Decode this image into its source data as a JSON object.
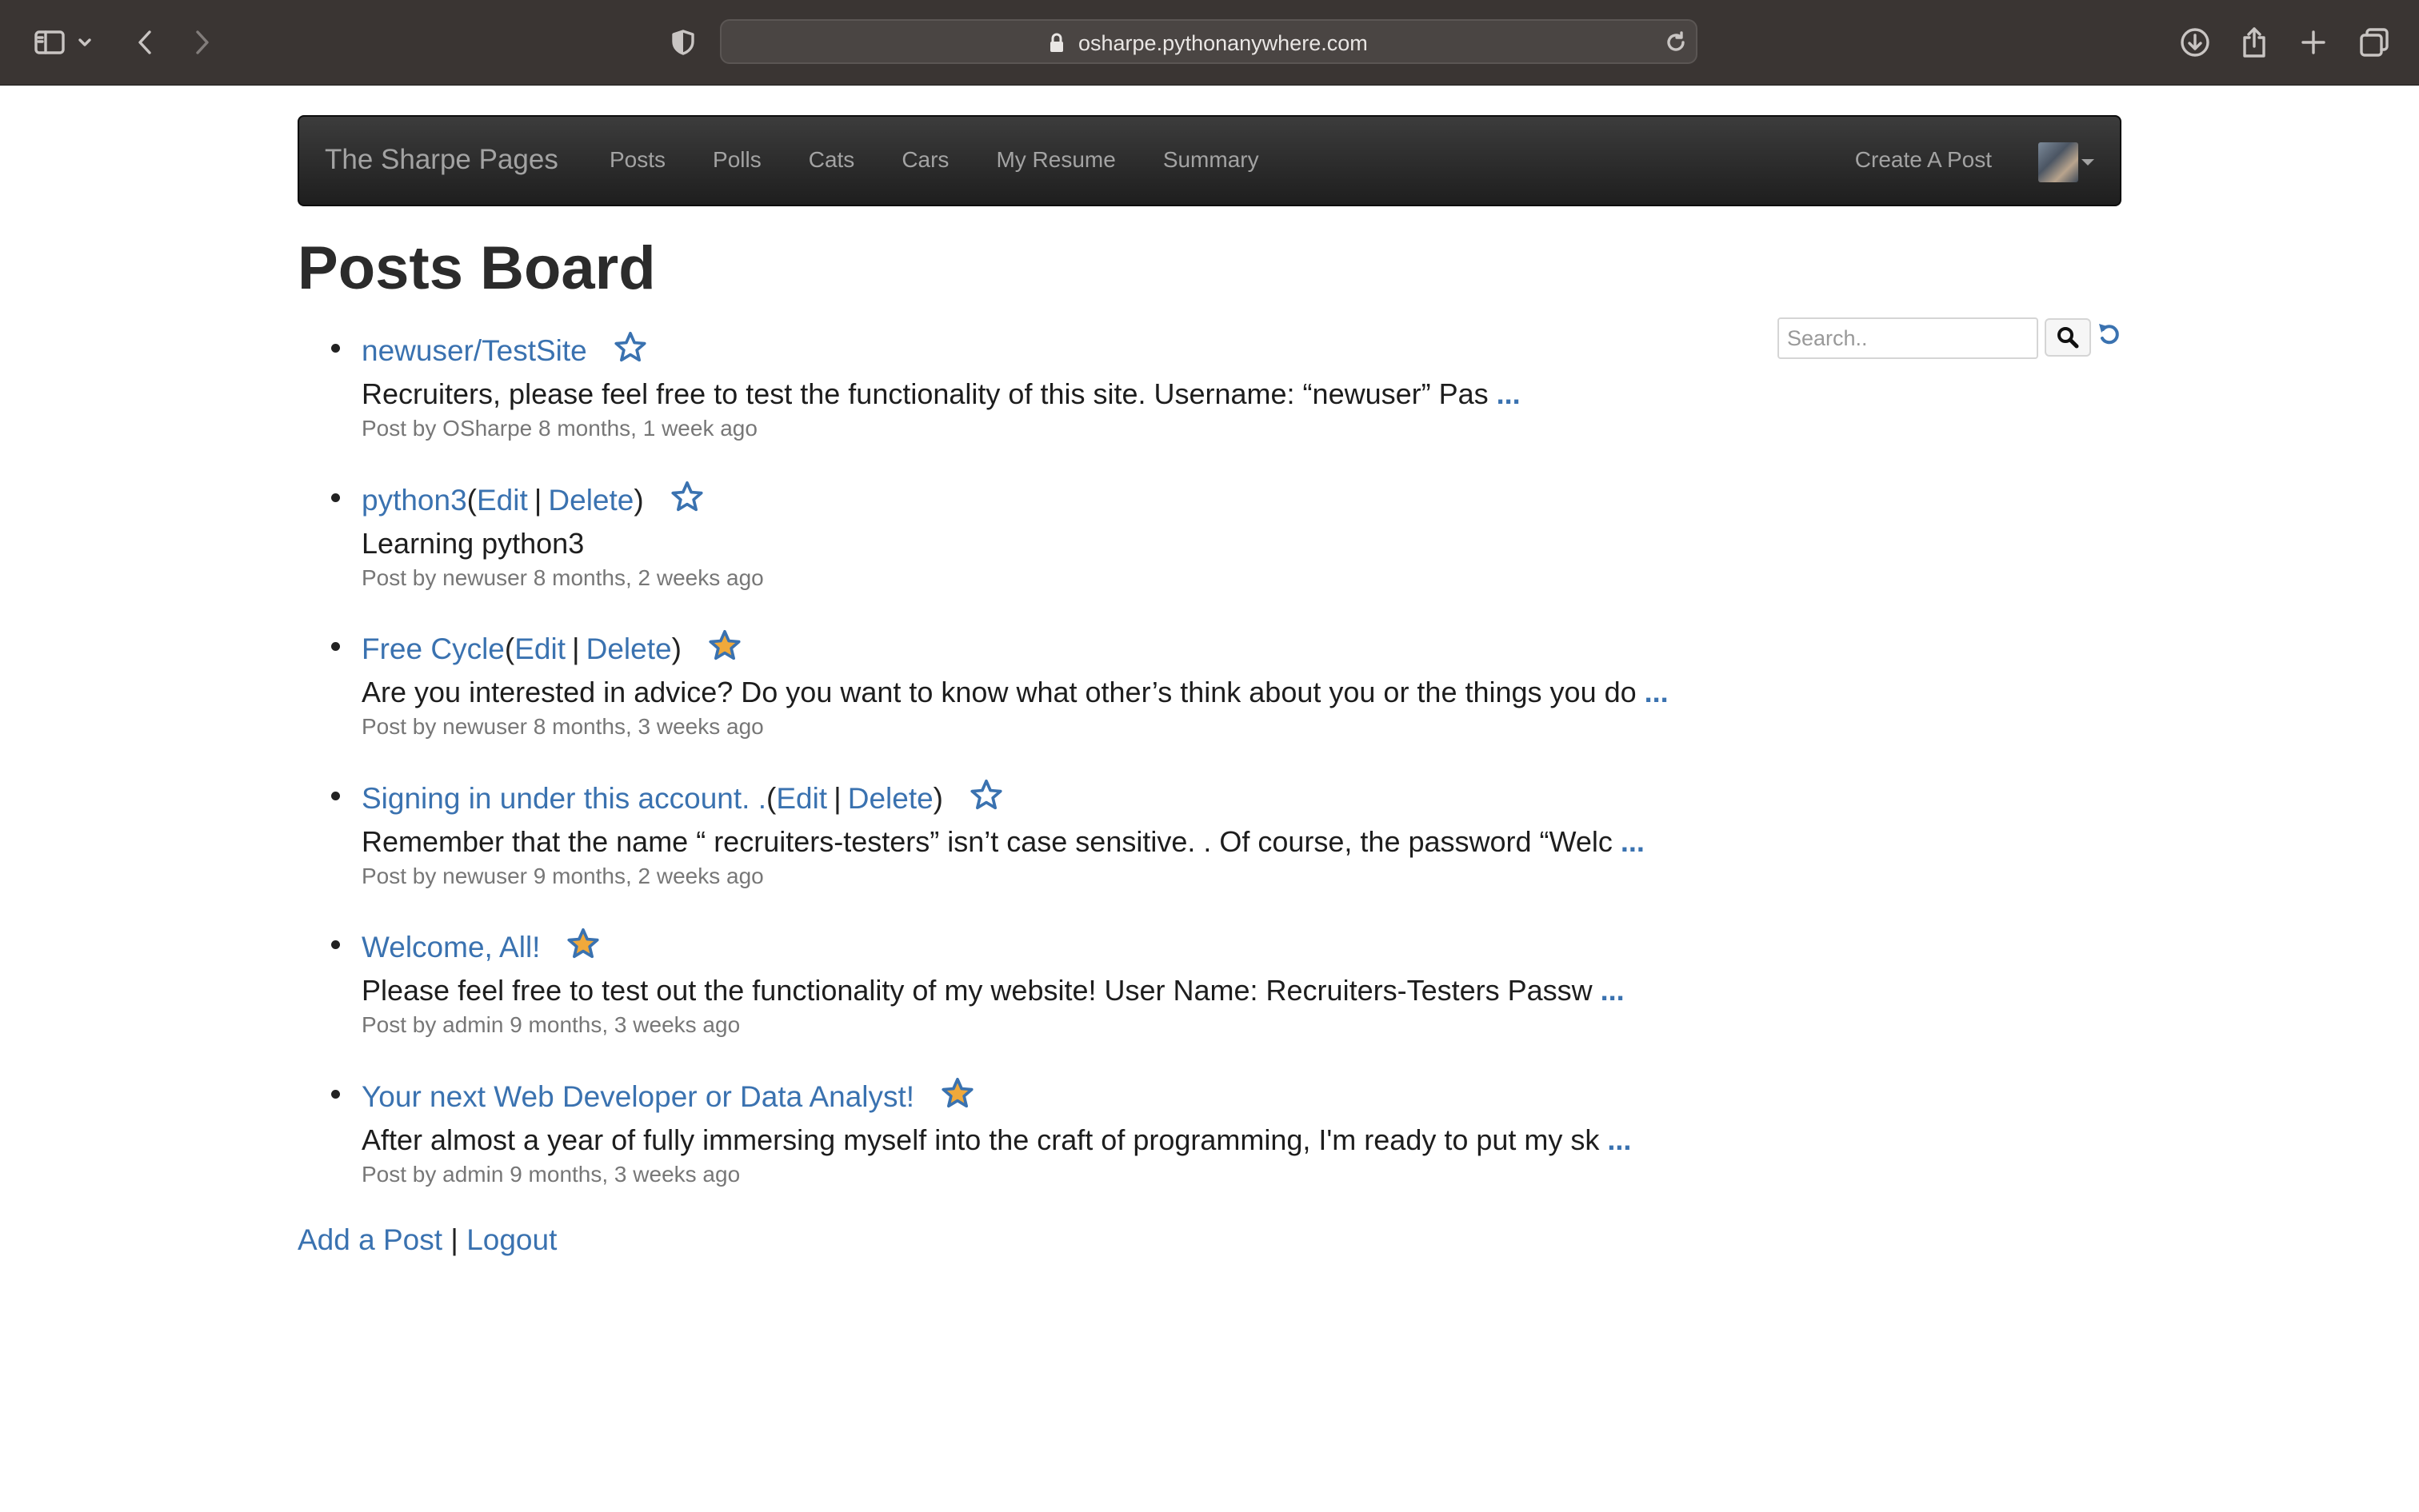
{
  "browser": {
    "url": "osharpe.pythonanywhere.com"
  },
  "navbar": {
    "brand": "The Sharpe Pages",
    "links": [
      "Posts",
      "Polls",
      "Cats",
      "Cars",
      "My Resume",
      "Summary"
    ],
    "create_post": "Create A Post"
  },
  "page": {
    "title": "Posts Board",
    "search_placeholder": "Search.."
  },
  "posts": [
    {
      "title": "newuser/TestSite",
      "editable": false,
      "starred": false,
      "excerpt": "Recruiters, please feel free to test the functionality of this site. Username: “newuser” Pas",
      "more": "...",
      "meta": "Post by OSharpe 8 months, 1 week ago"
    },
    {
      "title": "python3",
      "editable": true,
      "starred": false,
      "excerpt": "Learning python3",
      "more": "",
      "meta": "Post by newuser 8 months, 2 weeks ago"
    },
    {
      "title": "Free Cycle",
      "editable": true,
      "starred": true,
      "excerpt": "Are you interested in advice? Do you want to know what other’s think about you or the things you do",
      "more": "...",
      "meta": "Post by newuser 8 months, 3 weeks ago"
    },
    {
      "title": "Signing in under this account. .",
      "editable": true,
      "starred": false,
      "excerpt": "Remember that the name “ recruiters-testers” isn’t case sensitive. . Of course, the password “Welc",
      "more": "...",
      "meta": "Post by newuser 9 months, 2 weeks ago"
    },
    {
      "title": "Welcome, All!",
      "editable": false,
      "starred": true,
      "excerpt": "Please feel free to test out the functionality of my website! User Name: Recruiters-Testers Passw",
      "more": "...",
      "meta": "Post by admin 9 months, 3 weeks ago"
    },
    {
      "title": "Your next Web Developer or Data Analyst!",
      "editable": false,
      "starred": true,
      "excerpt": "After almost a year of fully immersing myself into the craft of programming, I'm ready to put my sk",
      "more": "...",
      "meta": "Post by admin 9 months, 3 weeks ago"
    }
  ],
  "labels": {
    "edit": "Edit",
    "delete": "Delete",
    "open_paren": "(",
    "close_paren": ")",
    "separator": "|"
  },
  "footer": {
    "add_post": "Add a Post",
    "separator": "|",
    "logout": "Logout"
  },
  "colors": {
    "link": "#3a72b0",
    "star_fill": "#f0a93b",
    "navbar": "#2a2a2a"
  },
  "icons": {
    "star": "star-icon",
    "search": "search-icon",
    "reset": "reset-icon"
  }
}
